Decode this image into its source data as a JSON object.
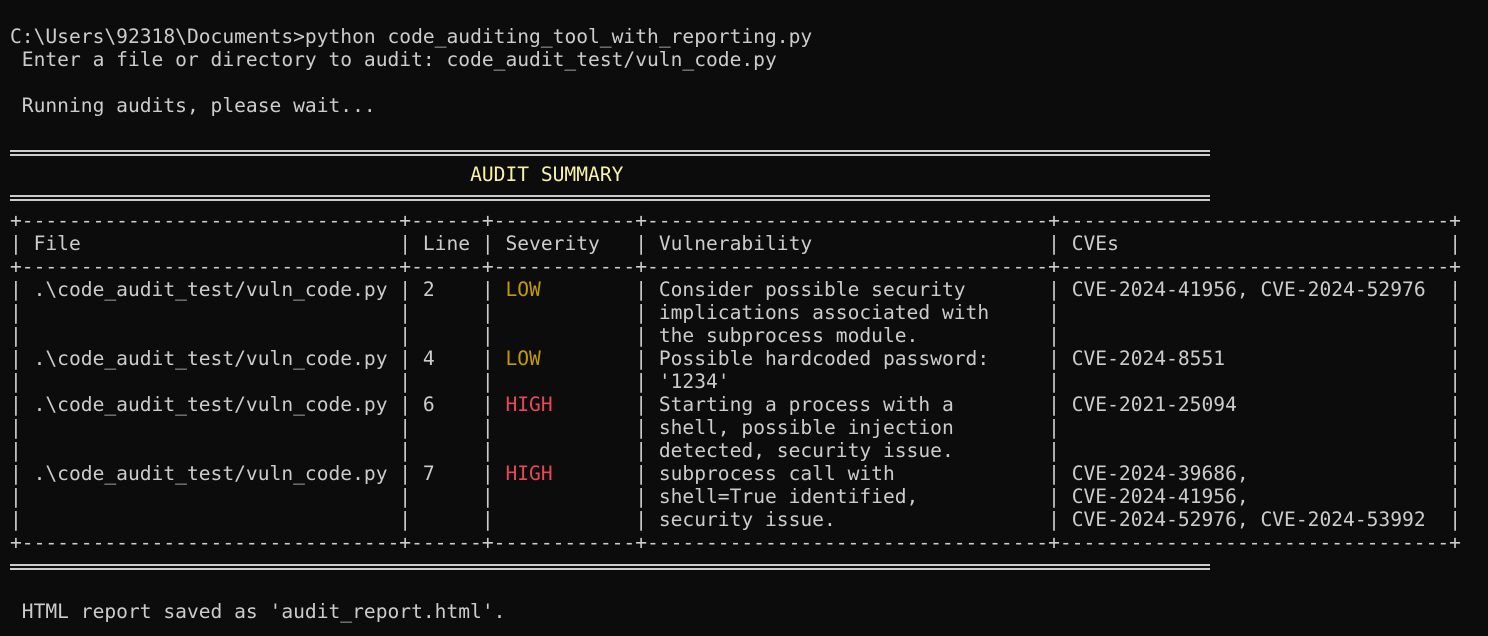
{
  "command": {
    "prompt": "C:\\Users\\92318\\Documents>",
    "text": "python code_auditing_tool_with_reporting.py"
  },
  "input_prompt": {
    "label": " Enter a file or directory to audit: ",
    "value": "code_audit_test/vuln_code.py"
  },
  "status_message": " Running audits, please wait...",
  "summary": {
    "title": "AUDIT SUMMARY"
  },
  "table": {
    "border": "+--------------------------------+------+------------+----------------------------------+---------------------------------+",
    "headers": [
      "File",
      "Line",
      "Severity",
      "Vulnerability",
      "CVEs"
    ],
    "rows": [
      {
        "file": ".\\code_audit_test/vuln_code.py",
        "line": "2",
        "severity": "LOW",
        "vulnerability": [
          "Consider possible security",
          "implications associated with",
          "the subprocess module."
        ],
        "cves": [
          "CVE-2024-41956, CVE-2024-52976"
        ]
      },
      {
        "file": ".\\code_audit_test/vuln_code.py",
        "line": "4",
        "severity": "LOW",
        "vulnerability": [
          "Possible hardcoded password:",
          "'1234'"
        ],
        "cves": [
          "CVE-2024-8551"
        ]
      },
      {
        "file": ".\\code_audit_test/vuln_code.py",
        "line": "6",
        "severity": "HIGH",
        "vulnerability": [
          "Starting a process with a",
          "shell, possible injection",
          "detected, security issue."
        ],
        "cves": [
          "CVE-2021-25094"
        ]
      },
      {
        "file": ".\\code_audit_test/vuln_code.py",
        "line": "7",
        "severity": "HIGH",
        "vulnerability": [
          "subprocess call with",
          "shell=True identified,",
          "security issue."
        ],
        "cves": [
          "CVE-2024-39686,",
          "CVE-2024-41956,",
          "CVE-2024-52976, CVE-2024-53992"
        ]
      }
    ]
  },
  "report_message": " HTML report saved as 'audit_report.html'.",
  "colors": {
    "background": "#0c0c0c",
    "text": "#cccccc",
    "summary_title": "#f9f1a5",
    "severity_low": "#c19c00",
    "severity_high": "#e74856"
  }
}
